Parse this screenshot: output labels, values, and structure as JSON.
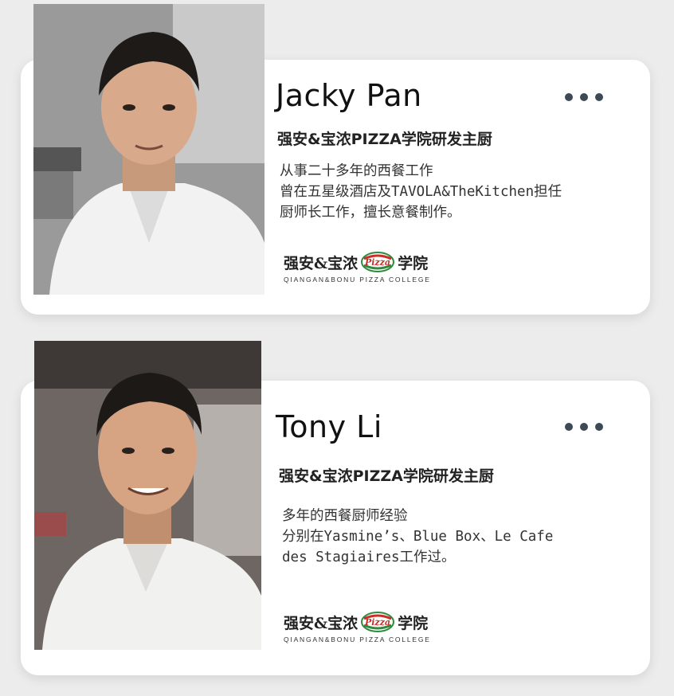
{
  "chefs": [
    {
      "name": "Jacky Pan",
      "title": "强安&宝浓PIZZA学院研发主厨",
      "description": [
        "从事二十多年的西餐工作",
        "曾在五星级酒店及TAVOLA&TheKitchen担任",
        "厨师长工作，擅长意餐制作。"
      ],
      "logo": {
        "cn_left": "强安&宝浓",
        "badge": "Pizza",
        "cn_right": "学院",
        "en": "QIANGAN&BONU PIZZA COLLEGE"
      },
      "menu_icon": "more-dots-icon"
    },
    {
      "name": "Tony Li",
      "title": "强安&宝浓PIZZA学院研发主厨",
      "description": [
        "多年的西餐厨师经验",
        "分别在Yasmine’s、Blue Box、Le Cafe",
        "des Stagiaires工作过。"
      ],
      "logo": {
        "cn_left": "强安&宝浓",
        "badge": "Pizza",
        "cn_right": "学院",
        "en": "QIANGAN&BONU PIZZA COLLEGE"
      },
      "menu_icon": "more-dots-icon"
    }
  ],
  "colors": {
    "badge_green": "#2e8b3d",
    "badge_red": "#c8302a",
    "dots": "#3d4a55"
  }
}
